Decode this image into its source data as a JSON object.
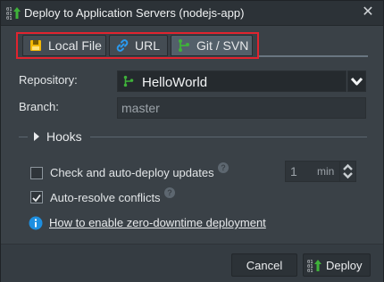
{
  "window": {
    "title": "Deploy to Application Servers (nodejs-app)",
    "close_label": "✕"
  },
  "tabs": [
    {
      "label": "Local File",
      "active": false
    },
    {
      "label": "URL",
      "active": false
    },
    {
      "label": "Git / SVN",
      "active": true
    }
  ],
  "form": {
    "repository_label": "Repository:",
    "repository_value": "HelloWorld",
    "branch_label": "Branch:",
    "branch_value": "master"
  },
  "hooks": {
    "label": "Hooks"
  },
  "options": {
    "auto_deploy_label": "Check and auto-deploy updates",
    "auto_deploy_checked": false,
    "auto_deploy_interval": "1",
    "auto_deploy_unit": "min",
    "auto_resolve_label": "Auto-resolve conflicts",
    "auto_resolve_checked": true
  },
  "link": {
    "text": "How to enable zero-downtime deployment"
  },
  "footer": {
    "cancel_label": "Cancel",
    "deploy_label": "Deploy"
  },
  "colors": {
    "highlight": "#e0242f",
    "git_green": "#3fb23a",
    "info_blue": "#1e8fe0",
    "local_file_yellow": "#f2b705"
  },
  "icons": [
    "deploy-icon",
    "close-icon",
    "file-icon",
    "link-icon",
    "git-icon",
    "chevron-down-icon",
    "help-icon",
    "info-icon"
  ]
}
